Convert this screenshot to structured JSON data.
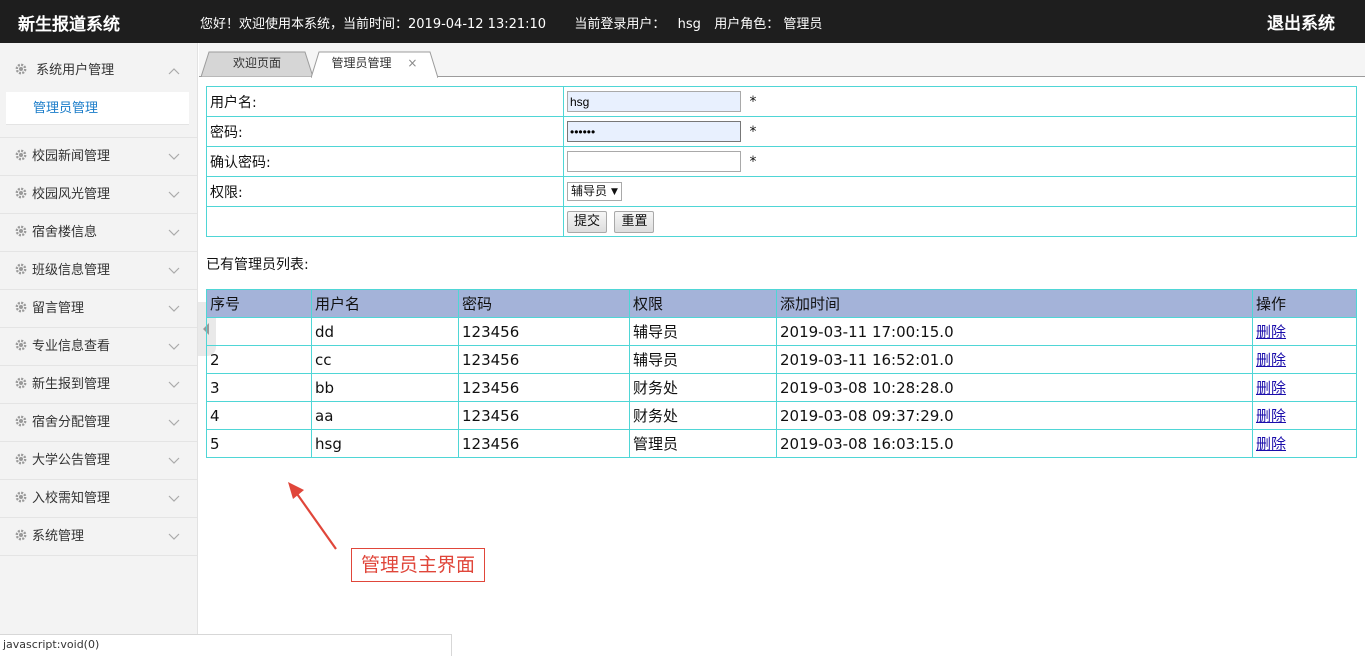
{
  "header": {
    "brand": "新生报道系统",
    "welcome_text": "您好！欢迎使用本系统，当前时间：2019-04-12 13:21:10",
    "user_label": "当前登录用户：",
    "username": "hsg",
    "role_label": "用户角色：",
    "role": "管理员",
    "logout": "退出系统"
  },
  "sidebar": {
    "active_group": "系统用户管理",
    "active_sub": "管理员管理",
    "items": [
      "校园新闻管理",
      "校园风光管理",
      "宿舍楼信息",
      "班级信息管理",
      "留言管理",
      "专业信息查看",
      "新生报到管理",
      "宿舍分配管理",
      "大学公告管理",
      "入校需知管理",
      "系统管理"
    ]
  },
  "tabs": [
    {
      "label": "欢迎页面",
      "active": false
    },
    {
      "label": "管理员管理",
      "active": true,
      "close": "×"
    }
  ],
  "form": {
    "username_label": "用户名:",
    "username_value": "hsg",
    "password_label": "密码:",
    "password_value": "••••••",
    "confirm_label": "确认密码:",
    "confirm_value": "",
    "role_label": "权限:",
    "role_selected": "辅导员",
    "required_mark": "*",
    "submit": "提交",
    "reset": "重置"
  },
  "list": {
    "title": "已有管理员列表:",
    "columns": [
      "序号",
      "用户名",
      "密码",
      "权限",
      "添加时间",
      "操作"
    ],
    "rows": [
      [
        "",
        "dd",
        "123456",
        "辅导员",
        "2019-03-11 17:00:15.0",
        "删除"
      ],
      [
        "2",
        "cc",
        "123456",
        "辅导员",
        "2019-03-11 16:52:01.0",
        "删除"
      ],
      [
        "3",
        "bb",
        "123456",
        "财务处",
        "2019-03-08 10:28:28.0",
        "删除"
      ],
      [
        "4",
        "aa",
        "123456",
        "财务处",
        "2019-03-08 09:37:29.0",
        "删除"
      ],
      [
        "5",
        "hsg",
        "123456",
        "管理员",
        "2019-03-08 16:03:15.0",
        "删除"
      ]
    ]
  },
  "annotation": "管理员主界面",
  "statusbar": "javascript:void(0)",
  "colors": {
    "topbar": "#1e1e1e",
    "grid_header": "#a4b3d9",
    "border": "#4fd6d6",
    "annotation": "#e0463a",
    "link": "#1a0dab"
  }
}
